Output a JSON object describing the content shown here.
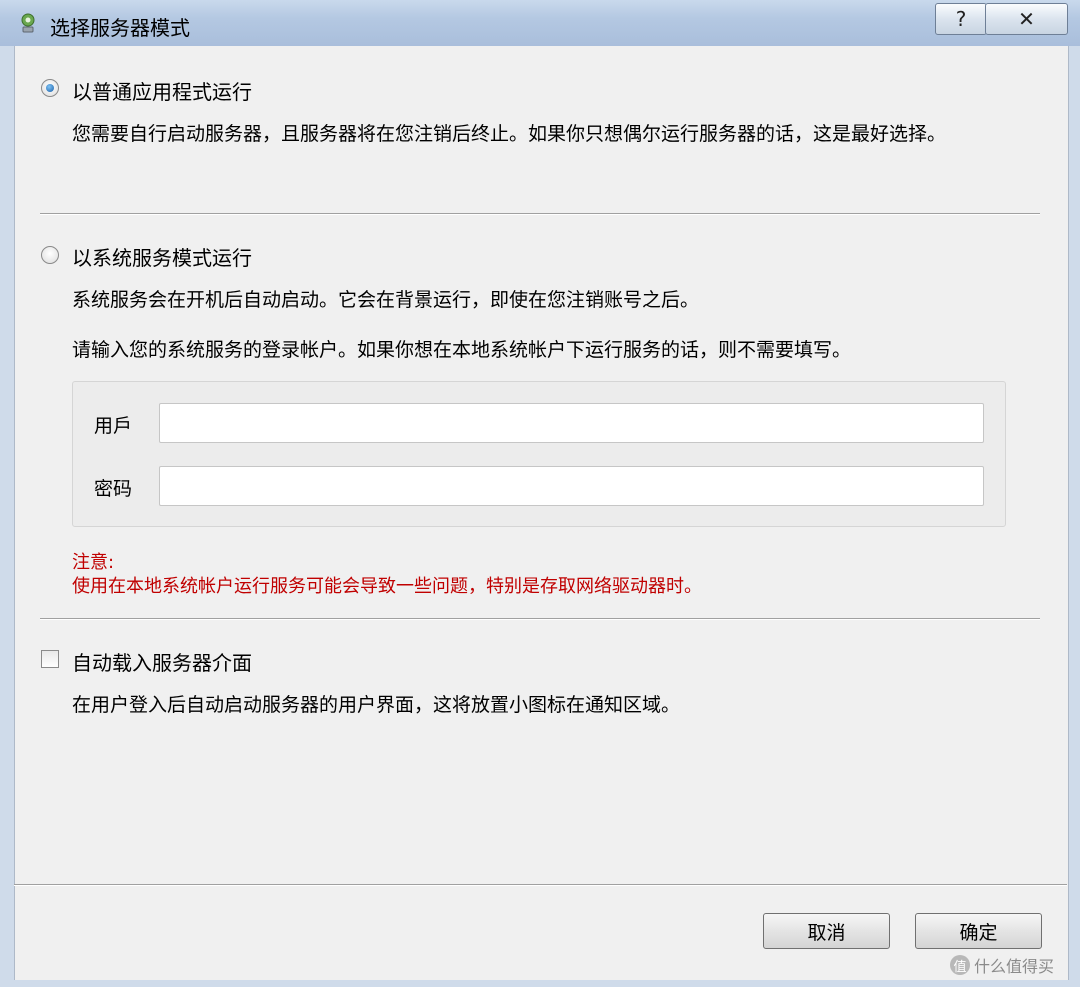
{
  "window": {
    "title": "选择服务器模式",
    "help_glyph": "?",
    "close_glyph": "✕"
  },
  "option_normal": {
    "label": "以普通应用程式运行",
    "selected": true,
    "description": "您需要自行启动服务器，且服务器将在您注销后终止。如果你只想偶尔运行服务器的话，这是最好选择。"
  },
  "option_service": {
    "label": "以系统服务模式运行",
    "selected": false,
    "description": "系统服务会在开机后自动启动。它会在背景运行，即使在您注销账号之后。",
    "account_hint": "请输入您的系统服务的登录帐户。如果你想在本地系统帐户下运行服务的话，则不需要填写。",
    "user_label": "用戶",
    "user_value": "",
    "password_label": "密码",
    "password_value": "",
    "warning_title": "注意:",
    "warning_text": "使用在本地系统帐户运行服务可能会导致一些问题，特别是存取网络驱动器时。"
  },
  "autoload": {
    "label": "自动载入服务器介面",
    "checked": false,
    "description": "在用户登入后自动启动服务器的用户界面，这将放置小图标在通知区域。"
  },
  "buttons": {
    "cancel": "取消",
    "ok": "确定"
  },
  "watermark": {
    "icon": "值",
    "text": "什么值得买"
  },
  "colors": {
    "warning": "#c00000",
    "titlebar": "#b4c8e2"
  }
}
